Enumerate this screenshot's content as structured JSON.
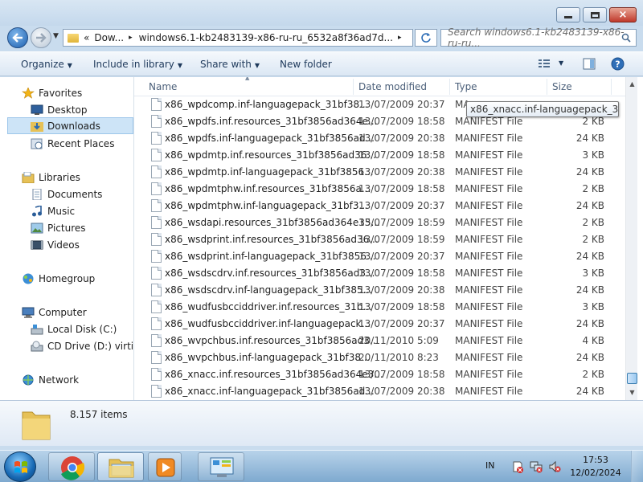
{
  "window": {
    "controls": {
      "minimize": "minimize",
      "maximize": "maximize",
      "close": "×"
    }
  },
  "navigation": {
    "back_icon": "back-arrow-icon",
    "forward_icon": "forward-arrow-icon",
    "breadcrumb_prefix": "«",
    "breadcrumb": [
      "Dow...",
      "windows6.1-kb2483139-x86-ru-ru_6532a8f36ad7d..."
    ],
    "breadcrumb_arrow": "▸",
    "search_placeholder": "Search windows6.1-kb2483139-x86-ru-ru..."
  },
  "toolbar": {
    "organize": "Organize",
    "include_in_library": "Include in library",
    "share_with": "Share with",
    "new_folder": "New folder"
  },
  "sidebar": {
    "favorites": "Favorites",
    "desktop": "Desktop",
    "downloads": "Downloads",
    "recent_places": "Recent Places",
    "libraries": "Libraries",
    "documents": "Documents",
    "music": "Music",
    "pictures": "Pictures",
    "videos": "Videos",
    "homegroup": "Homegroup",
    "computer": "Computer",
    "local_disk": "Local Disk (C:)",
    "cd_drive": "CD Drive (D:) virtio-w",
    "network": "Network"
  },
  "file_list": {
    "columns": {
      "name": "Name",
      "date": "Date modified",
      "type": "Type",
      "size": "Size"
    },
    "rows": [
      {
        "name": "x86_wpdcomp.inf-languagepack_31bf38...",
        "date": "13/07/2009 20:37",
        "type": "MA",
        "size": ""
      },
      {
        "name": "x86_wpdfs.inf.resources_31bf3856ad364e...",
        "date": "13/07/2009 18:58",
        "type": "MANIFEST File",
        "size": "2 KB"
      },
      {
        "name": "x86_wpdfs.inf-languagepack_31bf3856ad...",
        "date": "13/07/2009 20:38",
        "type": "MANIFEST File",
        "size": "24 KB"
      },
      {
        "name": "x86_wpdmtp.inf.resources_31bf3856ad36...",
        "date": "13/07/2009 18:58",
        "type": "MANIFEST File",
        "size": "3 KB"
      },
      {
        "name": "x86_wpdmtp.inf-languagepack_31bf3856...",
        "date": "13/07/2009 20:38",
        "type": "MANIFEST File",
        "size": "24 KB"
      },
      {
        "name": "x86_wpdmtphw.inf.resources_31bf3856a...",
        "date": "13/07/2009 18:58",
        "type": "MANIFEST File",
        "size": "2 KB"
      },
      {
        "name": "x86_wpdmtphw.inf-languagepack_31bf3...",
        "date": "13/07/2009 20:37",
        "type": "MANIFEST File",
        "size": "24 KB"
      },
      {
        "name": "x86_wsdapi.resources_31bf3856ad364e35...",
        "date": "13/07/2009 18:59",
        "type": "MANIFEST File",
        "size": "2 KB"
      },
      {
        "name": "x86_wsdprint.inf.resources_31bf3856ad36...",
        "date": "13/07/2009 18:59",
        "type": "MANIFEST File",
        "size": "2 KB"
      },
      {
        "name": "x86_wsdprint.inf-languagepack_31bf3856...",
        "date": "13/07/2009 20:37",
        "type": "MANIFEST File",
        "size": "24 KB"
      },
      {
        "name": "x86_wsdscdrv.inf.resources_31bf3856ad3...",
        "date": "13/07/2009 18:58",
        "type": "MANIFEST File",
        "size": "3 KB"
      },
      {
        "name": "x86_wsdscdrv.inf-languagepack_31bf385...",
        "date": "13/07/2009 20:38",
        "type": "MANIFEST File",
        "size": "24 KB"
      },
      {
        "name": "x86_wudfusbcciddriver.inf.resources_31b...",
        "date": "13/07/2009 18:58",
        "type": "MANIFEST File",
        "size": "3 KB"
      },
      {
        "name": "x86_wudfusbcciddriver.inf-languagepack...",
        "date": "13/07/2009 20:37",
        "type": "MANIFEST File",
        "size": "24 KB"
      },
      {
        "name": "x86_wvpchbus.inf.resources_31bf3856ad3...",
        "date": "20/11/2010 5:09",
        "type": "MANIFEST File",
        "size": "4 KB"
      },
      {
        "name": "x86_wvpchbus.inf-languagepack_31bf38...",
        "date": "20/11/2010 8:23",
        "type": "MANIFEST File",
        "size": "24 KB"
      },
      {
        "name": "x86_xnacc.inf.resources_31bf3856ad364e3...",
        "date": "13/07/2009 18:58",
        "type": "MANIFEST File",
        "size": "2 KB"
      },
      {
        "name": "x86_xnacc.inf-languagepack_31bf3856ad...",
        "date": "13/07/2009 20:38",
        "type": "MANIFEST File",
        "size": "24 KB"
      }
    ],
    "tooltip": "x86_xnacc.inf-languagepack_31..."
  },
  "details": {
    "item_count": "8.157 items"
  },
  "taskbar": {
    "language": "IN",
    "time": "17:53",
    "date": "12/02/2024"
  },
  "colors": {
    "accent": "#3c7fb1",
    "selection": "#cde4f7",
    "taskbar": "#7ea9cf"
  }
}
